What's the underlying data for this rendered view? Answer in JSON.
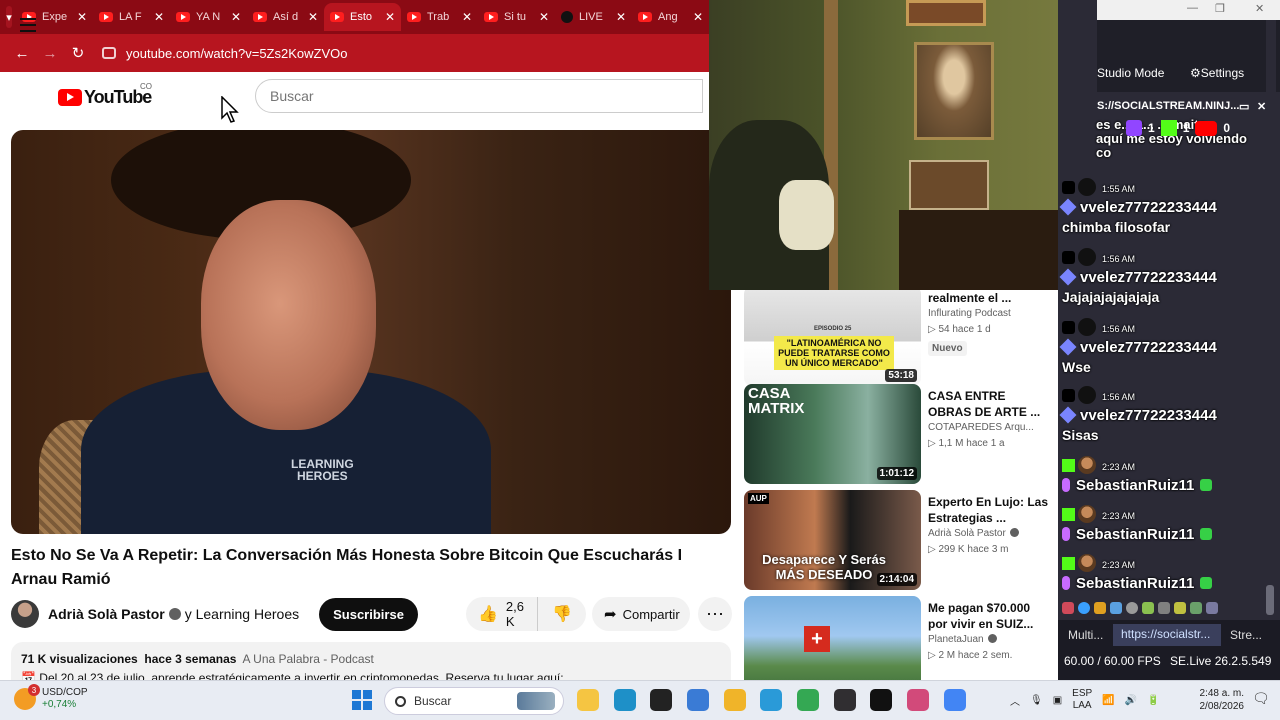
{
  "browser": {
    "tabs": [
      {
        "label": "Expe",
        "icon": "youtube-icon",
        "active": false
      },
      {
        "label": "LA F",
        "icon": "youtube-icon",
        "active": false
      },
      {
        "label": "YA N",
        "icon": "youtube-icon",
        "active": false
      },
      {
        "label": "Así d",
        "icon": "youtube-icon",
        "active": false
      },
      {
        "label": "Esto",
        "icon": "youtube-icon",
        "active": true
      },
      {
        "label": "Trab",
        "icon": "youtube-icon",
        "active": false
      },
      {
        "label": "Si tu",
        "icon": "youtube-icon",
        "active": false
      },
      {
        "label": "LIVE",
        "icon": "tiktok-icon",
        "active": false
      },
      {
        "label": "Ang",
        "icon": "youtube-icon",
        "active": false
      }
    ],
    "url": "youtube.com/watch?v=5Zs2KowZVOo",
    "accent": "#b7151f"
  },
  "youtube": {
    "logo_text": "YouTube",
    "country": "CO",
    "search_placeholder": "Buscar",
    "video_title": "Esto No Se Va A Repetir: La Conversación Más Honesta Sobre Bitcoin Que Escucharás I Arnau Ramió",
    "shirt_text_1": "LEARNING",
    "shirt_text_2": "HEROES",
    "channel_name": "Adrià Solà Pastor",
    "collab": "y Learning Heroes",
    "subscribe_label": "Suscribirse",
    "likes": "2,6 K",
    "share_label": "Compartir",
    "views": "71 K visualizaciones",
    "date": "hace 3 semanas",
    "tag": "A Una Palabra - Podcast",
    "desc_line": "Del 20 al 23 de julio, aprende estratégicamente a invertir en criptomonedas. Reserva tu lugar aquí:"
  },
  "recommendations": [
    {
      "title": "realmente el ...",
      "channel": "Influrating Podcast",
      "stats": "▷ 54   hace 1 d",
      "badge": "Nuevo",
      "duration": "53:18",
      "thumb_text": "\"LATINOAMÉRICA NO PUEDE TRATARSE COMO UN ÚNICO MERCADO\"",
      "thumb_small": "EPISODIO 25",
      "verified": false
    },
    {
      "title": "CASA ENTRE OBRAS DE ARTE ...",
      "channel": "COTAPAREDES Arqu...",
      "stats": "▷ 1,1 M   hace 1 a",
      "badge": "",
      "duration": "1:01:12",
      "thumb_text": "CASA MATRIX",
      "thumb_small": "",
      "verified": false
    },
    {
      "title": "Experto En Lujo: Las Estrategias ...",
      "channel": "Adrià Solà Pastor",
      "stats": "▷ 299 K   hace 3 m",
      "badge": "",
      "duration": "2:14:04",
      "thumb_text": "Desaparece Y Serás MÁS DESEADO",
      "thumb_small": "AUP",
      "verified": true
    },
    {
      "title": "Me pagan $70.000 por vivir en SUIZ...",
      "channel": "PlanetaJuan",
      "stats": "▷ 2 M   hace 2 sem.",
      "badge": "",
      "duration": "",
      "thumb_text": "",
      "thumb_small": "",
      "verified": true
    }
  ],
  "socialstream": {
    "studio_mode": "Studio Mode",
    "settings": "Settings",
    "url_header": "S://SOCIALSTREAM.NINJ...",
    "top_partial_1": "es e... a... ... maito",
    "top_partial_2": "aquí me estoy volviendo",
    "top_partial_3": "co",
    "twitch_count": "1",
    "kick_count": "1",
    "youtube_count": "0",
    "messages": [
      {
        "time": "1:55 AM",
        "user": "vvelez77722233444",
        "text": "chimba filosofar",
        "platform": "tiktok"
      },
      {
        "time": "1:56 AM",
        "user": "vvelez77722233444",
        "text": "Jajajajajajajaja",
        "platform": "tiktok"
      },
      {
        "time": "1:56 AM",
        "user": "vvelez77722233444",
        "text": "Wse",
        "platform": "tiktok"
      },
      {
        "time": "1:56 AM",
        "user": "vvelez77722233444",
        "text": "Sisas",
        "platform": "tiktok"
      },
      {
        "time": "2:23 AM",
        "user": "SebastianRuiz11",
        "text": "",
        "platform": "kick"
      },
      {
        "time": "2:23 AM",
        "user": "SebastianRuiz11",
        "text": "",
        "platform": "kick"
      },
      {
        "time": "2:23 AM",
        "user": "SebastianRuiz11",
        "text": "",
        "platform": "kick"
      }
    ],
    "bottom_tabs": [
      "Multi...",
      "https://socialstr...",
      "Stre..."
    ],
    "fps": "60.00 / 60.00 FPS",
    "version": "SE.Live 26.2.5.549"
  },
  "taskbar": {
    "ticker": "USD/COP",
    "change": "+0,74%",
    "badge": "3",
    "search": "Buscar",
    "lang1": "ESP",
    "lang2": "LAA",
    "time": "2:48 a. m.",
    "date": "2/08/2026"
  }
}
